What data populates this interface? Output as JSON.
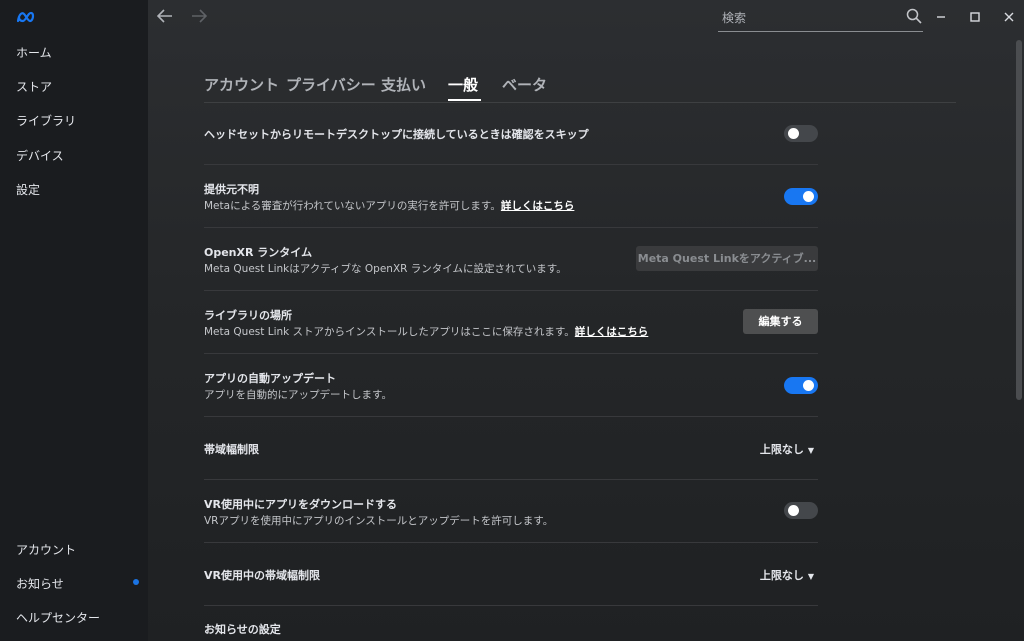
{
  "sidebar": {
    "items": [
      {
        "label": "ホーム"
      },
      {
        "label": "ストア"
      },
      {
        "label": "ライブラリ"
      },
      {
        "label": "デバイス"
      },
      {
        "label": "設定"
      }
    ],
    "bottom_items": [
      {
        "label": "アカウント"
      },
      {
        "label": "お知らせ"
      },
      {
        "label": "ヘルプセンター"
      }
    ]
  },
  "search": {
    "placeholder": "検索"
  },
  "icons": {
    "logo": "meta-logo",
    "back": "arrow-left",
    "forward": "arrow-right",
    "search": "magnifier",
    "minimize": "minimize",
    "maximize": "maximize",
    "close": "close"
  },
  "colors": {
    "accent": "#1877f2",
    "background": "#1c1e21"
  },
  "tabs": [
    {
      "label": "アカウント"
    },
    {
      "label": "プライバシー"
    },
    {
      "label": "支払い"
    },
    {
      "label": "一般",
      "active": true
    },
    {
      "label": "ベータ"
    }
  ],
  "settings": {
    "skip_confirm": {
      "title": "ヘッドセットからリモートデスクトップに接続しているときは確認をスキップ",
      "enabled": false
    },
    "unknown_sources": {
      "title": "提供元不明",
      "desc": "Metaによる審査が行われていないアプリの実行を許可します。",
      "link": "詳しくはこちら",
      "enabled": true
    },
    "openxr": {
      "title": "OpenXR ランタイム",
      "desc": "Meta Quest Linkはアクティブな OpenXR ランタイムに設定されています。",
      "button": "Meta Quest Linkをアクティブ..."
    },
    "library": {
      "title": "ライブラリの場所",
      "desc": "Meta Quest Link ストアからインストールしたアプリはここに保存されます。",
      "link": "詳しくはこちら",
      "button": "編集する"
    },
    "auto_update": {
      "title": "アプリの自動アップデート",
      "desc": "アプリを自動的にアップデートします。",
      "enabled": true
    },
    "bandwidth": {
      "title": "帯域幅制限",
      "value": "上限なし"
    },
    "vr_download": {
      "title": "VR使用中にアプリをダウンロードする",
      "desc": "VRアプリを使用中にアプリのインストールとアップデートを許可します。",
      "enabled": false
    },
    "vr_bandwidth": {
      "title": "VR使用中の帯域幅制限",
      "value": "上限なし"
    },
    "notifications": {
      "title": "お知らせの設定"
    }
  }
}
